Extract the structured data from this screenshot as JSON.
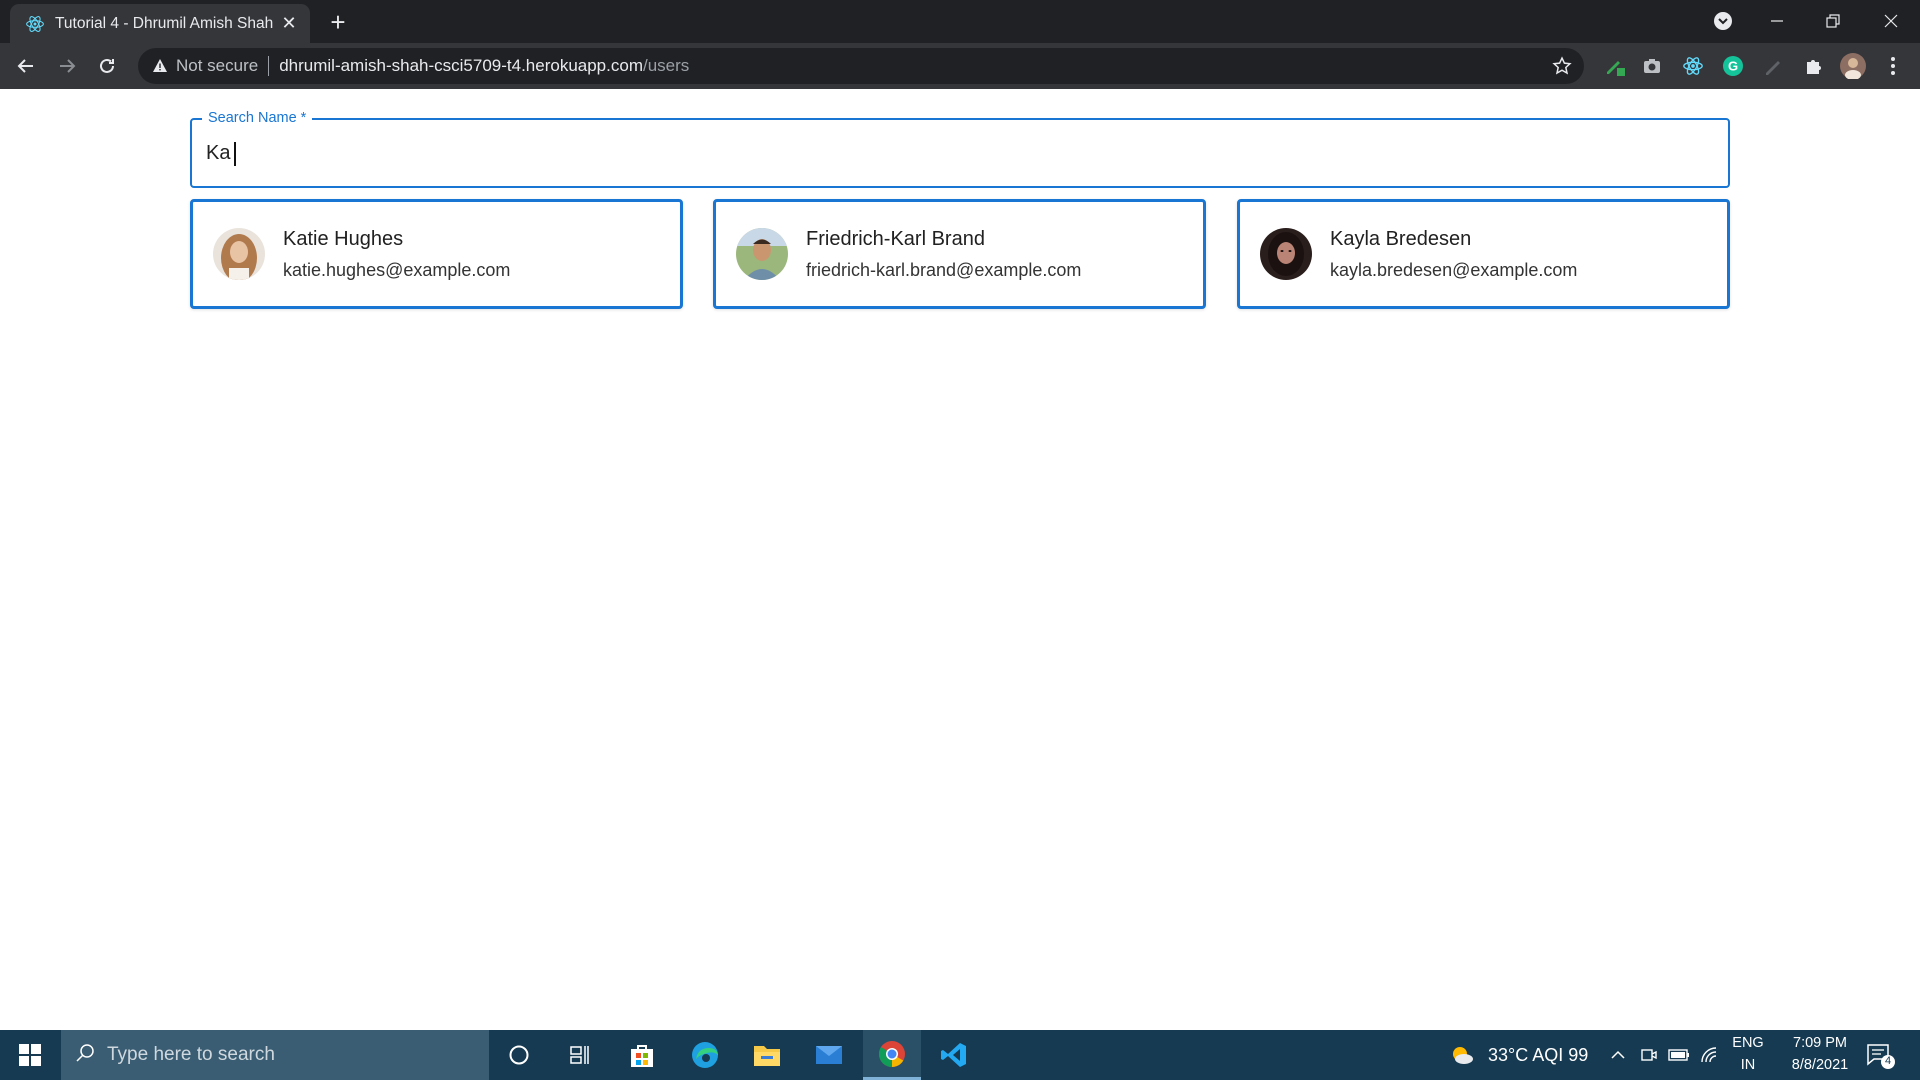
{
  "browser": {
    "tab_title": "Tutorial 4 - Dhrumil Amish Shah",
    "security_label": "Not secure",
    "url_host": "dhrumil-amish-shah-csci5709-t4.herokuapp.com",
    "url_path": "/users"
  },
  "search": {
    "label": "Search Name *",
    "value": "Ka"
  },
  "users": [
    {
      "name": "Katie Hughes",
      "email": "katie.hughes@example.com"
    },
    {
      "name": "Friedrich-Karl Brand",
      "email": "friedrich-karl.brand@example.com"
    },
    {
      "name": "Kayla Bredesen",
      "email": "kayla.bredesen@example.com"
    }
  ],
  "taskbar": {
    "search_placeholder": "Type here to search",
    "weather": "33°C  AQI 99",
    "language_top": "ENG",
    "language_bottom": "IN",
    "time": "7:09 PM",
    "date": "8/8/2021",
    "notification_count": "4"
  },
  "colors": {
    "accent": "#1976d2",
    "chrome_dark": "#202124",
    "chrome_toolbar": "#35363a",
    "taskbar": "#153a52"
  }
}
